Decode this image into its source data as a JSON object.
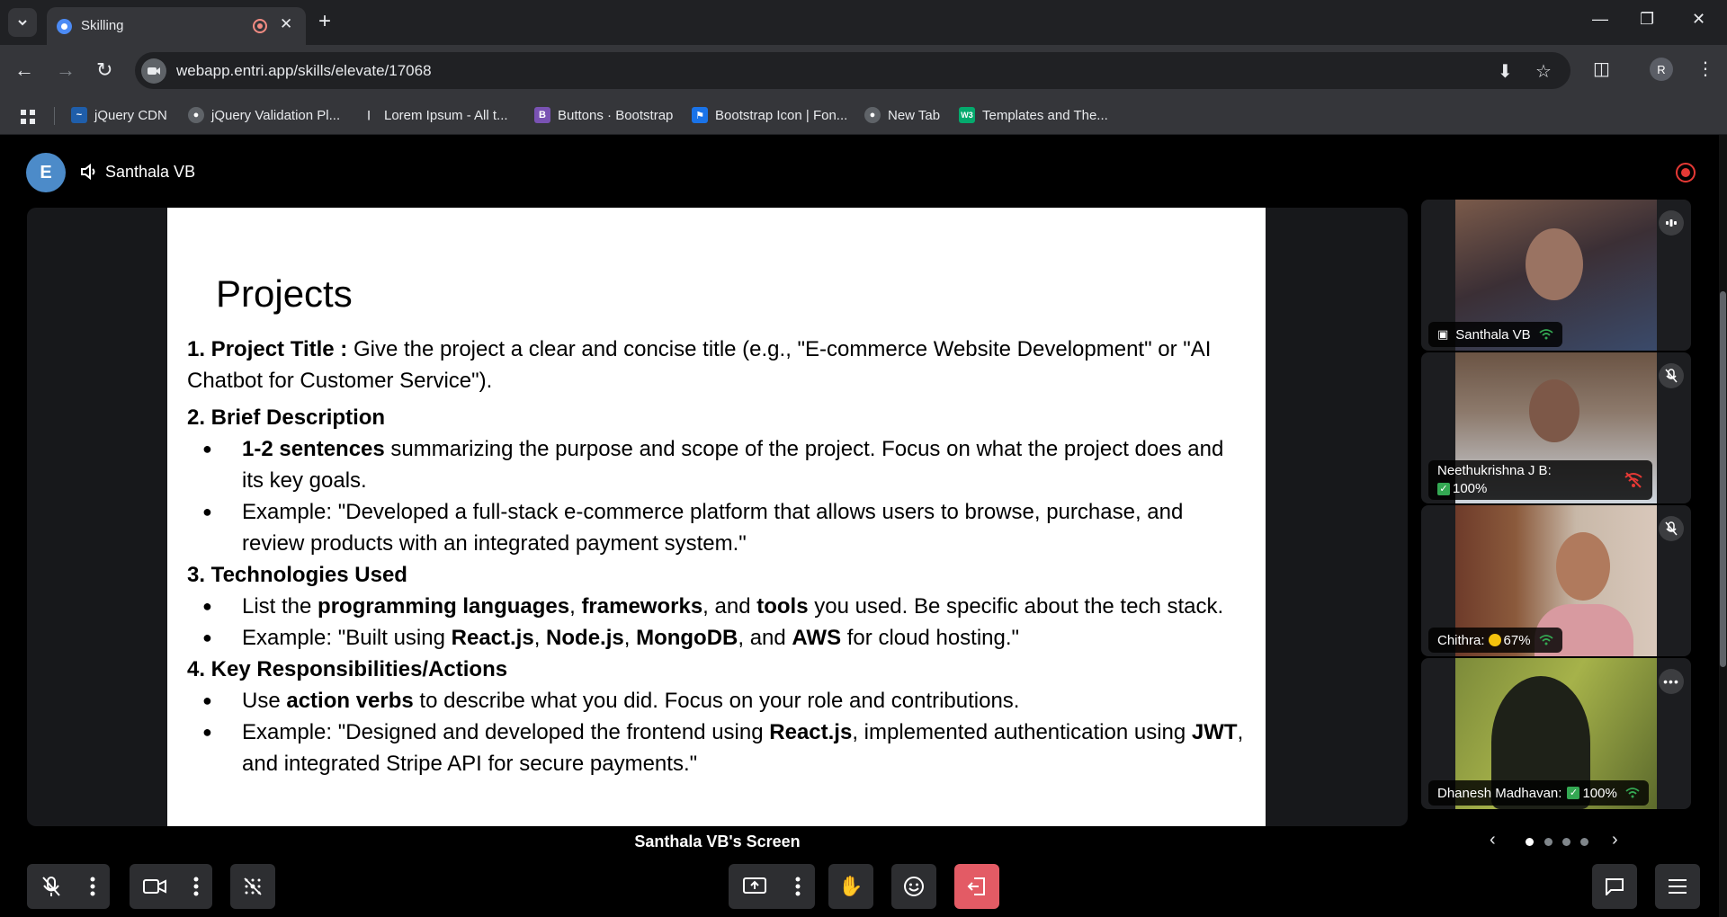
{
  "browser": {
    "tab": {
      "title": "Skilling"
    },
    "url": "webapp.entri.app/skills/elevate/17068",
    "profile_initial": "R",
    "bookmarks": [
      {
        "label": "jQuery CDN",
        "icon": "jquery-icon"
      },
      {
        "label": "jQuery Validation Pl...",
        "icon": "globe-icon"
      },
      {
        "label": "Lorem Ipsum - All t...",
        "icon": "lorem-icon"
      },
      {
        "label": "Buttons · Bootstrap",
        "icon": "bootstrap-icon"
      },
      {
        "label": "Bootstrap Icon | Fon...",
        "icon": "bookmark-flag-icon"
      },
      {
        "label": "New Tab",
        "icon": "globe-icon"
      },
      {
        "label": "Templates and The...",
        "icon": "w3schools-icon"
      }
    ]
  },
  "meeting": {
    "logo": "E",
    "speaker": "Santhala VB",
    "screen_label": "Santhala VB's Screen",
    "participants": [
      {
        "name": "Santhala VB",
        "status": ""
      },
      {
        "name": "Neethukrishna J B:",
        "status": "100%"
      },
      {
        "name": "Chithra:",
        "status": "67%"
      },
      {
        "name": "Dhanesh Madhavan:",
        "status": "100%"
      }
    ],
    "pager": {
      "pages": 4,
      "active": 1
    }
  },
  "slide": {
    "title": "Projects",
    "s1_head": "1. Project Title  :",
    "s1_text": " Give the project a clear and concise title (e.g., \"E-commerce Website Development\" or \"AI Chatbot for Customer Service\").",
    "s2_head": "2. Brief Description",
    "s2_b1_bold": "1-2 sentences",
    "s2_b1_text": " summarizing the purpose and scope of the project. Focus on what the project does and its key goals.",
    "s2_b2_text": "Example: \"Developed a full-stack e-commerce platform that allows users to browse, purchase, and review products with an integrated payment system.\"",
    "s3_head": "3. Technologies Used",
    "s3_b1": [
      "List the ",
      "programming languages",
      ", ",
      "frameworks",
      ", and ",
      "tools",
      " you used. Be specific about the tech stack."
    ],
    "s3_b2": [
      "Example: \"Built using ",
      "React.js",
      ", ",
      "Node.js",
      ", ",
      "MongoDB",
      ", and ",
      "AWS",
      " for cloud hosting.\""
    ],
    "s4_head": "4. Key Responsibilities/Actions",
    "s4_b1": [
      "Use ",
      "action verbs",
      " to describe what you did. Focus on your role and contributions."
    ],
    "s4_b2": [
      "Example: \"Designed and developed the frontend using ",
      "React.js",
      ", implemented authentication using ",
      "JWT",
      ", and integrated Stripe API for secure payments.\""
    ]
  },
  "colors": {
    "chrome_dark": "#202124",
    "chrome_mid": "#35363a",
    "record_red": "#e53935",
    "leave_red": "#e35b65",
    "logo_blue": "#4c8bc9",
    "signal_green": "#34a853"
  }
}
